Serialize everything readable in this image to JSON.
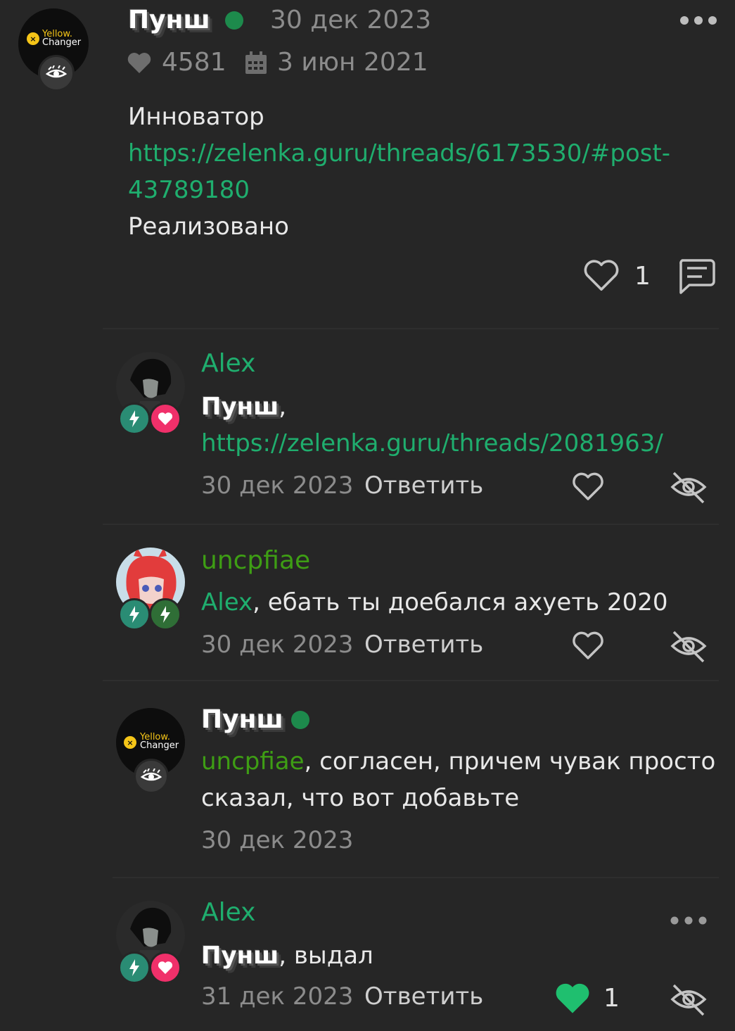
{
  "post": {
    "author": "Пунш",
    "date": "30 дек 2023",
    "likes_count": "4581",
    "joined_date": "3 июн 2021",
    "body_line1": "Инноватор",
    "link_part1": "https://zelenka.guru/threads/6173530/#post-",
    "link_part2": "43789180",
    "body_line3": "Реализовано",
    "like_count": "1",
    "avatar_brand_line1": "Yellow.",
    "avatar_brand_line2": "Changer"
  },
  "comments": [
    {
      "author": "Alex",
      "mention": "Пунш",
      "mention_sep": ",",
      "text": "",
      "link": "https://zelenka.guru/threads/2081963/",
      "date": "30 дек 2023",
      "reply_label": "Ответить"
    },
    {
      "author": "uncpfiae",
      "mention": "Alex",
      "text": ", ебать ты доебался ахуеть 2020",
      "date": "30 дек 2023",
      "reply_label": "Ответить"
    },
    {
      "author": "Пунш",
      "mention": "uncpfiae",
      "text_line1": ", согласен, причем чувак просто",
      "text_line2": "сказал, что вот добавьте",
      "date": "30 дек 2023",
      "avatar_brand_line1": "Yellow.",
      "avatar_brand_line2": "Changer"
    },
    {
      "author": "Alex",
      "mention": "Пунш",
      "text": ", выдал",
      "date": "31 дек 2023",
      "reply_label": "Ответить",
      "like_count": "1"
    }
  ],
  "colors": {
    "background": "#262626",
    "link_green": "#1fae6e",
    "lime_green": "#3e9e14",
    "online_dot": "#1d8a4c",
    "liked_heart": "#1fbf6f"
  },
  "icons": [
    "heart-icon",
    "calendar-icon",
    "more-dots-icon",
    "comment-icon",
    "hide-eye-icon",
    "bolt-icon",
    "pink-heart-badge-icon",
    "eye-badge-icon"
  ]
}
